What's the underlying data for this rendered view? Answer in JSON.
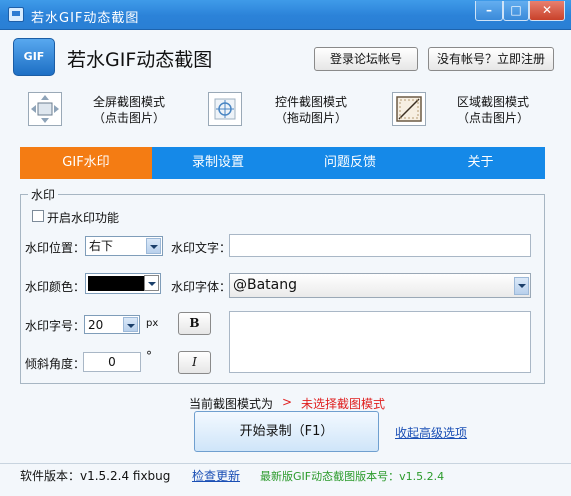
{
  "window": {
    "title": "若水GIF动态截图",
    "minimize": "–",
    "maximize": "□",
    "close": "✕"
  },
  "header": {
    "logo_text": "GIF",
    "app_name": "若水GIF动态截图",
    "login_button": "登录论坛帐号",
    "register_button": "没有帐号？立即注册"
  },
  "modes": [
    {
      "icon": "fullscreen-mode-icon",
      "title": "全屏截图模式",
      "hint": "（点击图片）"
    },
    {
      "icon": "crosshair-mode-icon",
      "title": "控件截图模式",
      "hint": "（拖动图片）"
    },
    {
      "icon": "region-mode-icon",
      "title": "区域截图模式",
      "hint": "（点击图片）"
    }
  ],
  "tabs": [
    {
      "label": "GIF水印",
      "active": true
    },
    {
      "label": "录制设置",
      "active": false
    },
    {
      "label": "问题反馈",
      "active": false
    },
    {
      "label": "关于",
      "active": false
    }
  ],
  "watermark": {
    "group_title": "水印",
    "enable_label": "开启水印功能",
    "enabled": false,
    "position_label": "水印位置：",
    "position_value": "右下",
    "text_label": "水印文字：",
    "text_value": "",
    "color_label": "水印颜色：",
    "color_value": "#000000",
    "font_label": "水印字体：",
    "font_value": "@Batang",
    "size_label": "水印字号：",
    "size_value": "20",
    "size_unit": "px",
    "bold_button": "B",
    "italic_button": "I",
    "angle_label": "倾斜角度：",
    "angle_value": "0",
    "angle_unit": "°",
    "text_area_value": ""
  },
  "status": {
    "mode_label": "当前截图模式为",
    "arrow": ">",
    "mode_value": "未选择截图模式",
    "start_button": "开始录制（F1）",
    "collapse_link": "收起高级选项"
  },
  "footer": {
    "version_text": "软件版本：v1.5.2.4 fixbug",
    "check_update": "检查更新",
    "latest_text": "最新版GIF动态截图版本号：v1.5.2.4"
  },
  "colors": {
    "tab_bar": "#1589e8",
    "active_tab": "#f47c13",
    "status_red": "#e02020",
    "latest_green": "#2a9a2a",
    "link_blue": "#1a4fb5"
  }
}
